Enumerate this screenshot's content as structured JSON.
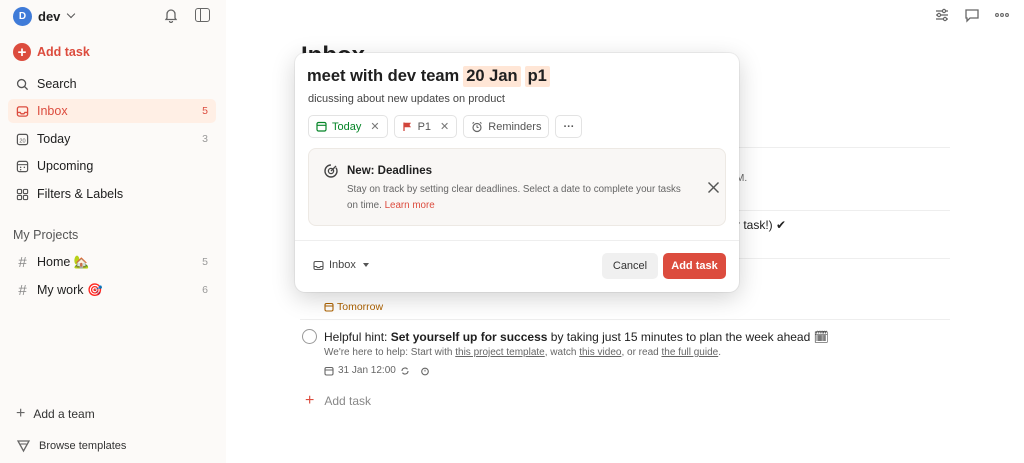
{
  "workspace": {
    "avatar_letter": "D",
    "name": "dev"
  },
  "sidebar": {
    "add_task": "Add task",
    "nav": [
      {
        "label": "Search",
        "icon": "search-icon",
        "count": ""
      },
      {
        "label": "Inbox",
        "icon": "inbox-icon",
        "count": "5"
      },
      {
        "label": "Today",
        "icon": "calendar-20-icon",
        "count": "3"
      },
      {
        "label": "Upcoming",
        "icon": "calendar-grid-icon",
        "count": ""
      },
      {
        "label": "Filters & Labels",
        "icon": "grid-icon",
        "count": ""
      }
    ],
    "projects_title": "My Projects",
    "projects": [
      {
        "label": "Home 🏡",
        "count": "5"
      },
      {
        "label": "My work 🎯",
        "count": "6"
      }
    ],
    "add_team": "Add a team",
    "browse_templates": "Browse templates"
  },
  "main": {
    "heading": "Inbox",
    "partial_m": "M.",
    "partial_task": "r task!) ✔",
    "tomorrow_label": "Tomorrow",
    "hint": {
      "prefix": "Helpful hint: ",
      "bold": "Set yourself up for success",
      "rest": " by taking just 15 minutes to plan the week ahead 🗓",
      "desc_1": "We're here to help: Start with ",
      "link_1": "this project template",
      "desc_2": ", watch ",
      "link_2": "this video",
      "desc_3": ", or read ",
      "link_3": "the full guide",
      "desc_4": ".",
      "date": "31 Jan 12:00"
    },
    "add_task": "Add task"
  },
  "modal": {
    "title_text": "meet with dev team",
    "date_token": "20 Jan",
    "priority_token": "p1",
    "description": "dicussing about new updates on product",
    "chips": {
      "date": "Today",
      "priority": "P1",
      "reminders": "Reminders",
      "more": "···"
    },
    "callout": {
      "title": "New: Deadlines",
      "text": "Stay on track by setting clear deadlines. Select a date to complete your tasks on time. ",
      "link": "Learn more"
    },
    "project": "Inbox",
    "cancel": "Cancel",
    "submit": "Add task"
  },
  "colors": {
    "accent": "#dc4c3e",
    "active_bg": "#ffefe5",
    "today_green": "#058527",
    "sidebar_bg": "#fcfaf8"
  }
}
